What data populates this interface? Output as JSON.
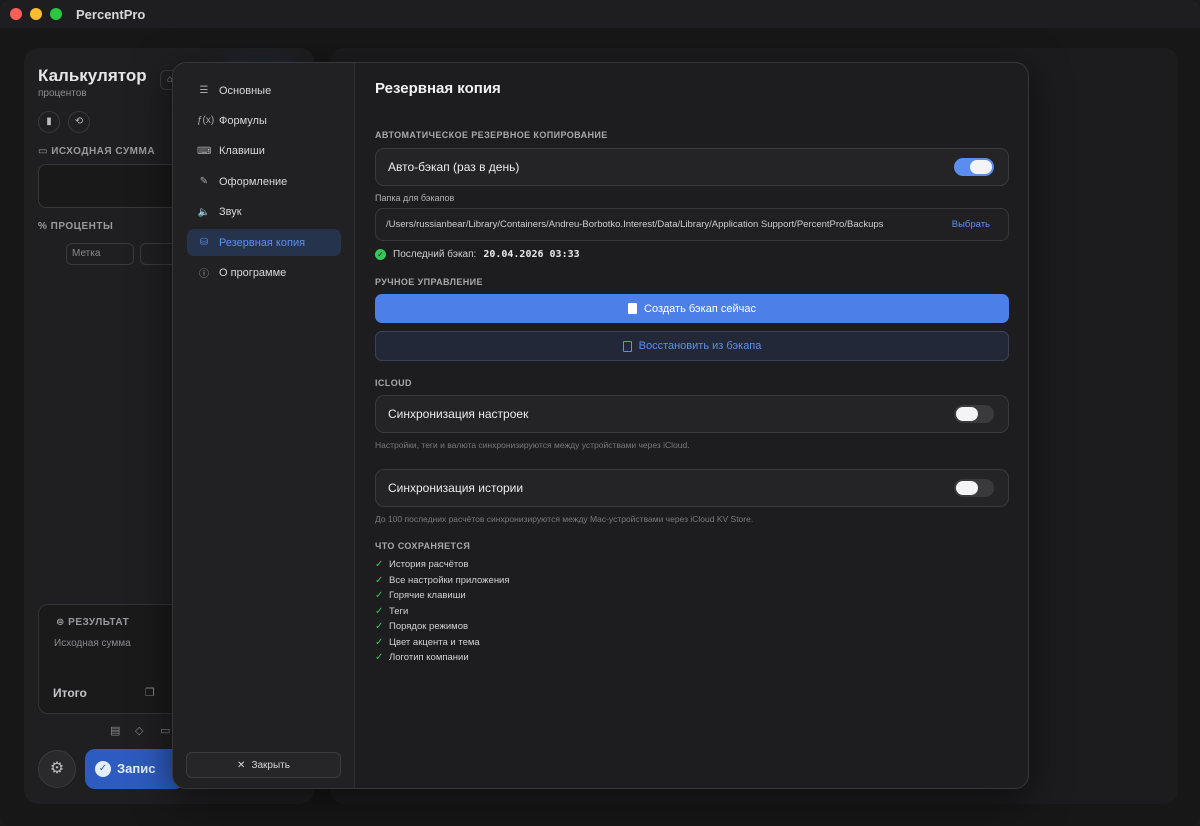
{
  "window": {
    "title": "PercentPro"
  },
  "background": {
    "calc_title": "Калькулятор",
    "calc_subtitle": "процентов",
    "source_sum_label": "ИСХОДНАЯ СУММА",
    "percents_label": "ПРОЦЕНТЫ",
    "tag_placeholder": "Метка",
    "result_label": "РЕЗУЛЬТАТ",
    "result_source": "Исходная сумма",
    "total_label": "Итого",
    "record_label": "Запис"
  },
  "sidebar": {
    "items": [
      {
        "label": "Основные",
        "icon": "sliders-icon",
        "glyph": "☰"
      },
      {
        "label": "Формулы",
        "icon": "function-icon",
        "glyph": "ƒ(x)"
      },
      {
        "label": "Клавиши",
        "icon": "keyboard-icon",
        "glyph": "⌨"
      },
      {
        "label": "Оформление",
        "icon": "brush-icon",
        "glyph": "✎"
      },
      {
        "label": "Звук",
        "icon": "speaker-icon",
        "glyph": "🔈"
      },
      {
        "label": "Резервная копия",
        "icon": "drive-icon",
        "glyph": "⛁"
      },
      {
        "label": "О программе",
        "icon": "info-icon",
        "glyph": "ⓘ"
      }
    ],
    "active_index": 5,
    "close_label": "Закрыть"
  },
  "content": {
    "title": "Резервная копия",
    "auto_section": "АВТОМАТИЧЕСКОЕ РЕЗЕРВНОЕ КОПИРОВАНИЕ",
    "auto_backup_label": "Авто-бэкап (раз в день)",
    "auto_backup_on": true,
    "folder_label": "Папка для бэкапов",
    "folder_path": "/Users/russianbear/Library/Containers/Andreu-Borbotko.Interest/Data/Library/Application Support/PercentPro/Backups",
    "choose_label": "Выбрать",
    "last_backup_label": "Последний бэкап:",
    "last_backup_value": "20.04.2026 03:33",
    "manual_section": "РУЧНОЕ УПРАВЛЕНИЕ",
    "create_backup_label": "Создать бэкап сейчас",
    "restore_label": "Восстановить из бэкапа",
    "icloud_section": "ICLOUD",
    "sync_settings_label": "Синхронизация настроек",
    "sync_settings_on": false,
    "sync_settings_hint": "Настройки, теги и валюта синхронизируются между устройствами через iCloud.",
    "sync_history_label": "Синхронизация истории",
    "sync_history_on": false,
    "sync_history_hint": "До 100 последних расчётов синхронизируются между Mac-устройствами через iCloud KV Store.",
    "saved_section": "ЧТО СОХРАНЯЕТСЯ",
    "saved_items": [
      "История расчётов",
      "Все настройки приложения",
      "Горячие клавиши",
      "Теги",
      "Порядок режимов",
      "Цвет акцента и тема",
      "Логотип компании"
    ]
  },
  "colors": {
    "accent": "#4d7fe8",
    "accent_text": "#5d8ff0",
    "success": "#34c759"
  }
}
